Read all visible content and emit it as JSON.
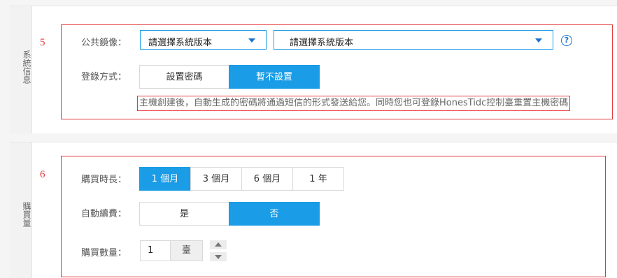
{
  "system_section": {
    "side_label": "系統信息",
    "step_number": "5",
    "image_label": "公共鏡像：",
    "image_select": "請選擇系統版本",
    "version_select": "請選擇系統版本",
    "help_glyph": "?",
    "login_label": "登錄方式：",
    "login_options": [
      "設置密碼",
      "暫不設置"
    ],
    "login_selected": "暫不設置",
    "note": "主機創建後，自動生成的密碼將通過短信的形式發送給您。同時您也可登錄HonesTidc控制臺重置主機密碼"
  },
  "purchase_section": {
    "side_label": "購買量",
    "step_number": "6",
    "duration_label": "購買時長：",
    "duration_options": [
      "1 個月",
      "3 個月",
      "6 個月",
      "1 年"
    ],
    "duration_selected": "1 個月",
    "renew_label": "自動續費：",
    "renew_options": [
      "是",
      "否"
    ],
    "renew_selected": "否",
    "quantity_label": "購買數量：",
    "quantity_value": "1",
    "quantity_unit": "臺"
  },
  "colors": {
    "accent": "#1a9ce6",
    "highlight_border": "#e4393c"
  },
  "icons": {
    "select_caret": "caret-down-icon",
    "help": "help-circle-icon",
    "stepper_up": "arrow-up-icon",
    "stepper_down": "arrow-down-icon"
  }
}
